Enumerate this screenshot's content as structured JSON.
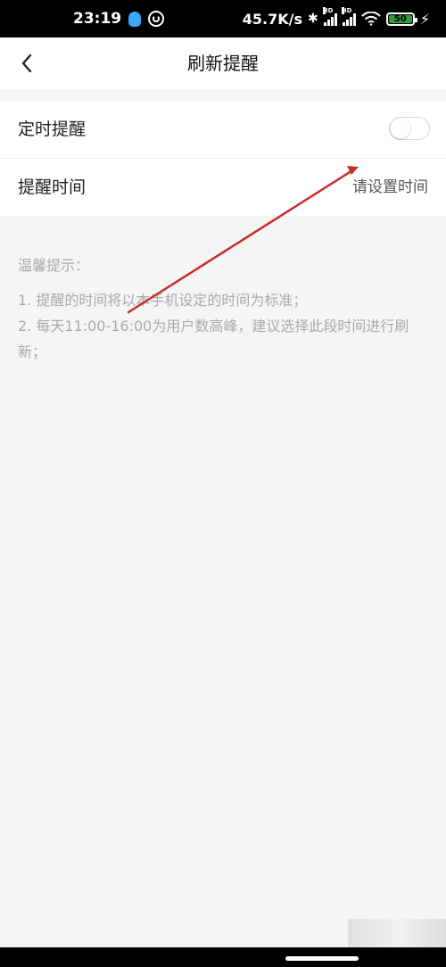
{
  "status_bar": {
    "time": "23:19",
    "speed": "45.7K/s",
    "battery": "50"
  },
  "nav": {
    "title": "刷新提醒"
  },
  "settings": {
    "timed_reminder_label": "定时提醒",
    "timed_reminder_enabled": false,
    "reminder_time_label": "提醒时间",
    "reminder_time_value": "请设置时间"
  },
  "tips": {
    "title": "温馨提示：",
    "items": [
      "1. 提醒的时间将以本手机设定的时间为标准；",
      "2. 每天11:00-16:00为用户数高峰，建议选择此段时间进行刷新；"
    ]
  },
  "colors": {
    "background": "#f5f5f5",
    "card": "#ffffff",
    "annotation_arrow": "#c92b2b",
    "battery_fill": "#2f9d3f"
  },
  "icons": {
    "back": "chevron-left-icon",
    "qq": "qq-icon",
    "target": "target-icon",
    "bluetooth": "bluetooth-icon",
    "signal": "signal-icon",
    "wifi": "wifi-icon",
    "battery": "battery-icon",
    "charging": "charging-icon"
  }
}
